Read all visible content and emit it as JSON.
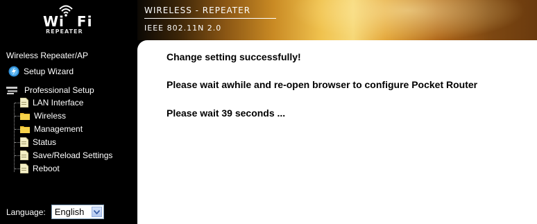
{
  "logo": {
    "wifi_left": "Wi",
    "wifi_right": "Fi",
    "subtitle": "REPEATER"
  },
  "banner": {
    "title": "WIRELESS - REPEATER",
    "subtitle": "IEEE 802.11N 2.0"
  },
  "sidebar": {
    "title": "Wireless Repeater/AP",
    "setup_wizard": "Setup Wizard",
    "professional_setup": "Professional Setup",
    "items": [
      {
        "label": "LAN Interface",
        "icon": "document-icon"
      },
      {
        "label": "Wireless",
        "icon": "folder-icon"
      },
      {
        "label": "Management",
        "icon": "folder-icon"
      },
      {
        "label": "Status",
        "icon": "document-icon"
      },
      {
        "label": "Save/Reload Settings",
        "icon": "document-icon"
      },
      {
        "label": "Reboot",
        "icon": "document-icon"
      }
    ]
  },
  "language": {
    "label": "Language:",
    "selected": "English"
  },
  "main": {
    "line1": "Change setting successfully!",
    "line2": "Please wait awhile and re-open browser to configure Pocket Router",
    "line3": "Please wait 39 seconds ..."
  },
  "colors": {
    "background": "#000000",
    "banner_gold": "#f0c24e",
    "content_bg": "#ffffff"
  }
}
